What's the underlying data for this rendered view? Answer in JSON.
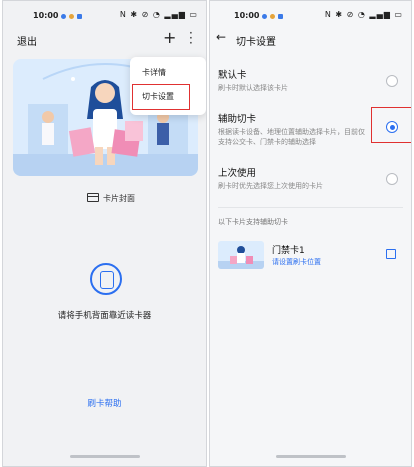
{
  "left": {
    "status": {
      "time": "10:00",
      "icons": "N ✱ ⊘ ◔ ▂▄▆ ▭"
    },
    "header": {
      "exit_label": "退出",
      "add_icon": "plus",
      "more_icon": "vertical-ellipsis"
    },
    "menu": {
      "items": [
        {
          "label": "卡详情"
        },
        {
          "label": "切卡设置"
        }
      ]
    },
    "cover_label": "卡片封面",
    "nfc_prompt": "请将手机背面靠近读卡器",
    "help_link": "刷卡帮助"
  },
  "right": {
    "status": {
      "time": "10:00",
      "icons": "N ✱ ⊘ ◔ ▂▄▆ ▭"
    },
    "header": {
      "title": "切卡设置"
    },
    "options": [
      {
        "title": "默认卡",
        "desc": "刷卡时默认选择该卡片",
        "selected": false
      },
      {
        "title": "辅助切卡",
        "desc_line1": "根据读卡设备、地理位置辅助选择卡片，目前仅",
        "desc_line2": "支持公交卡、门禁卡的辅助选择",
        "selected": true
      },
      {
        "title": "上次使用",
        "desc": "刷卡时优先选择您上次使用的卡片",
        "selected": false
      }
    ],
    "support_section_label": "以下卡片支持辅助切卡",
    "card": {
      "name": "门禁卡1",
      "link": "请设置刷卡位置"
    }
  },
  "colors": {
    "accent": "#2b6ff0",
    "highlight": "#e03131"
  }
}
